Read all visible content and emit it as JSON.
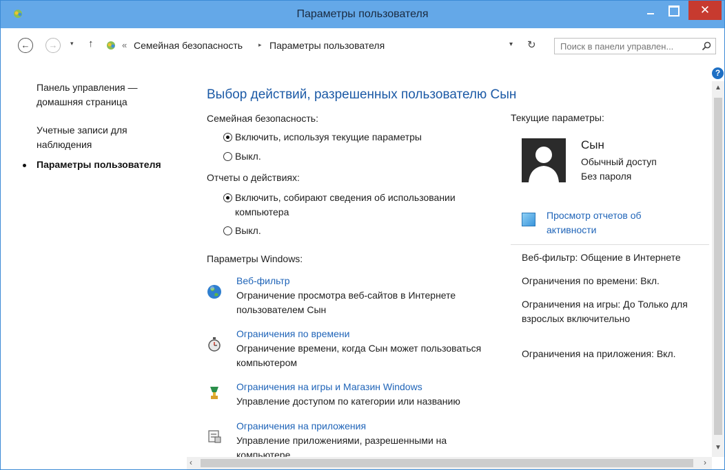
{
  "window": {
    "title": "Параметры пользователя",
    "close_label": "✕"
  },
  "address_bar": {
    "chevron": "«",
    "crumbs": [
      "Семейная безопасность",
      "Параметры пользователя"
    ],
    "separator": "▸",
    "search_placeholder": "Поиск в панели управлен..."
  },
  "nav": {
    "back": "←",
    "forward": "→",
    "up": "↑",
    "dropdown": "▾",
    "refresh": "↻"
  },
  "help_label": "?",
  "left_nav": {
    "items": [
      {
        "label": "Панель управления — домашняя страница"
      },
      {
        "label": "Учетные записи для наблюдения"
      }
    ],
    "current": "Параметры пользователя"
  },
  "main": {
    "heading": "Выбор действий, разрешенных пользователю Сын",
    "family_safety": {
      "label": "Семейная безопасность:",
      "options": [
        {
          "label": "Включить, используя текущие параметры",
          "checked": true
        },
        {
          "label": "Выкл.",
          "checked": false
        }
      ]
    },
    "activity_reports": {
      "label": "Отчеты о действиях:",
      "options": [
        {
          "label": "Включить, собирают сведения об использовании компьютера",
          "checked": true
        },
        {
          "label": "Выкл.",
          "checked": false
        }
      ]
    },
    "windows_settings": {
      "label": "Параметры Windows:",
      "items": [
        {
          "link": "Веб-фильтр",
          "desc": "Ограничение просмотра веб-сайтов в Интернете пользователем Сын",
          "icon": "globe-icon"
        },
        {
          "link": "Ограничения по времени",
          "desc": "Ограничение времени, когда Сын может пользоваться компьютером",
          "icon": "stopwatch-icon"
        },
        {
          "link": "Ограничения на игры и Магазин Windows",
          "desc": "Управление доступом по категории или названию",
          "icon": "trophy-icon"
        },
        {
          "link": "Ограничения на приложения",
          "desc": "Управление приложениями, разрешенными на компьютере",
          "icon": "app-list-icon"
        }
      ]
    }
  },
  "current_settings": {
    "title": "Текущие параметры:",
    "user_name": "Сын",
    "access": "Обычный доступ",
    "password": "Без пароля",
    "report_link": "Просмотр отчетов об активности",
    "info": [
      "Веб-фильтр: Общение в Интернете",
      "Ограничения по времени: Вкл.",
      "Ограничения на игры: До Только для взрослых включительно",
      "Ограничения на приложения: Вкл."
    ]
  },
  "scroll": {
    "up": "▲",
    "down": "▼",
    "left": "‹",
    "right": "›"
  },
  "colors": {
    "titlebar": "#64a8e8",
    "close": "#c73a2f",
    "link": "#1f64b8",
    "heading": "#1c5aa6"
  }
}
